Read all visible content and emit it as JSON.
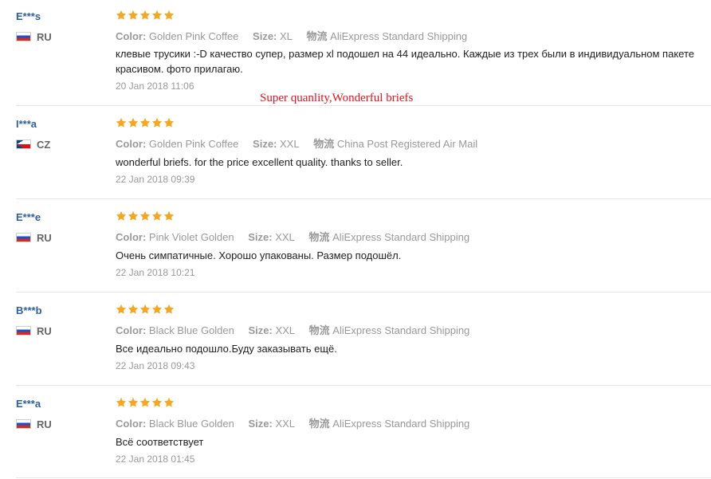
{
  "labels": {
    "color": "Color:",
    "size": "Size:",
    "shipping": "物流"
  },
  "star_color": "#f5a623",
  "overlay_caption": "Super quanlity,Wonderful briefs",
  "reviews": [
    {
      "user": "E***s",
      "country": "RU",
      "flag": "ru-flag",
      "rating": 5,
      "color": "Golden Pink Coffee",
      "size": "XL",
      "shipping": "AliExpress Standard Shipping",
      "feedback": "клевые трусики :-D качество супер, размер xl подошел на 44 идеально. Каждые из трех были в индивидуальном пакете красивом. фото прилагаю.",
      "date": "20 Jan 2018 11:06"
    },
    {
      "user": "I***a",
      "country": "CZ",
      "flag": "cz-flag",
      "rating": 5,
      "color": "Golden Pink Coffee",
      "size": "XXL",
      "shipping": "China Post Registered Air Mail",
      "feedback": "wonderful briefs. for the price excellent quality. thanks to seller.",
      "date": "22 Jan 2018 09:39"
    },
    {
      "user": "E***e",
      "country": "RU",
      "flag": "ru-flag",
      "rating": 5,
      "color": "Pink Violet Golden",
      "size": "XXL",
      "shipping": "AliExpress Standard Shipping",
      "feedback": "Очень симпатичные. Хорошо упакованы. Размер подошёл.",
      "date": "22 Jan 2018 10:21"
    },
    {
      "user": "B***b",
      "country": "RU",
      "flag": "ru-flag",
      "rating": 5,
      "color": "Black Blue Golden",
      "size": "XXL",
      "shipping": "AliExpress Standard Shipping",
      "feedback": "Все идеально подошло.Буду заказывать ещё.",
      "date": "22 Jan 2018 09:43"
    },
    {
      "user": "E***a",
      "country": "RU",
      "flag": "ru-flag",
      "rating": 5,
      "color": "Black Blue Golden",
      "size": "XXL",
      "shipping": "AliExpress Standard Shipping",
      "feedback": "Всё соответствует",
      "date": "22 Jan 2018 01:45"
    }
  ]
}
